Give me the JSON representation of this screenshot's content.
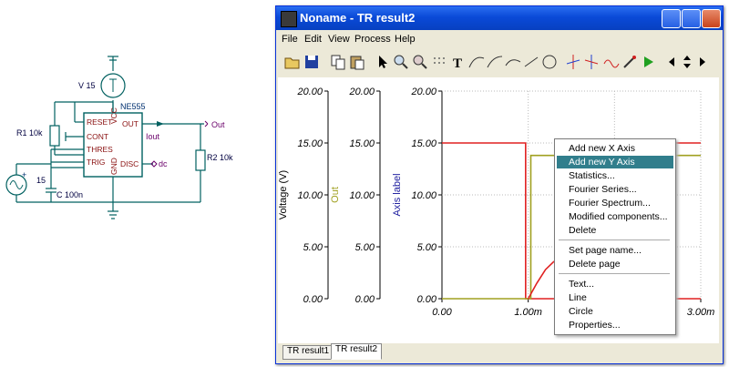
{
  "schematic": {
    "source_label": "V 15",
    "ic_name": "NE555",
    "pins": {
      "reset": "RESET",
      "cont": "CONT",
      "thres": "THRES",
      "trig": "TRIG",
      "out": "OUT",
      "disc": "DISC",
      "vcc": "VCC",
      "gnd": "GND"
    },
    "r1_label": "R1 10k",
    "r2_label": "R2 10k",
    "c_label": "C 100n",
    "gen_value": "15",
    "iout_label": "Iout",
    "dc_label": "dc",
    "out_label": "Out"
  },
  "window": {
    "title": "Noname - TR result2",
    "menu": [
      "File",
      "Edit",
      "View",
      "Process",
      "Help"
    ],
    "toolbar_icons": [
      "open-folder-icon",
      "save-disk-icon",
      "copy-icon",
      "paste-icon",
      "arrow-pointer-icon",
      "zoom-in-icon",
      "zoom-out-icon",
      "grid-icon",
      "text-tool-icon",
      "curve-tool-icon",
      "curve2-tool-icon",
      "curve3-tool-icon",
      "line-tool-icon",
      "circle-tool-icon",
      "cursor-a-icon",
      "cursor-b-icon",
      "waveform-icon",
      "probe-icon",
      "run-icon",
      "arrow-left-icon",
      "arrow-updown-icon",
      "arrow-right-icon"
    ]
  },
  "tabs": [
    "TR result1",
    "TR result2"
  ],
  "context_menu": {
    "items": [
      "Add new X Axis",
      "Add new Y Axis",
      "Statistics...",
      "Fourier Series...",
      "Fourier Spectrum...",
      "Modified components...",
      "Delete",
      "Set page name...",
      "Delete page",
      "Text...",
      "Line",
      "Circle",
      "Properties..."
    ],
    "highlighted": "Add new Y Axis"
  },
  "colors": {
    "voltage_trace": "#e02020",
    "out_trace": "#a0a020",
    "axis_label_blue": "#2020a0",
    "highlight": "#317e8c"
  },
  "chart_data": {
    "type": "line",
    "y_axes": [
      {
        "label": "Voltage (V)",
        "ticks": [
          "20.00",
          "15.00",
          "10.00",
          "5.00",
          "0.00"
        ],
        "ylim": [
          0,
          20
        ]
      },
      {
        "label": "Out",
        "ticks": [
          "20.00",
          "15.00",
          "10.00",
          "5.00",
          "0.00"
        ],
        "ylim": [
          0,
          20
        ]
      },
      {
        "label": "Axis label",
        "ticks": [
          "20.00",
          "15.00",
          "10.00",
          "5.00",
          "0.00"
        ],
        "ylim": [
          0,
          20
        ]
      }
    ],
    "x_ticks": [
      "0.00",
      "1.00m",
      "3.00m"
    ],
    "x_tick_values": [
      0,
      1,
      3
    ],
    "xlim": [
      0,
      3
    ],
    "grid": true,
    "series": [
      {
        "x": [
          0,
          0.97,
          0.97,
          3.0
        ],
        "y": [
          15,
          15,
          0,
          0
        ]
      },
      {
        "x": [
          0,
          1.0,
          1.03,
          1.03,
          1.3,
          3.0
        ],
        "y": [
          0,
          0,
          0,
          13.8,
          13.8,
          13.8
        ]
      },
      {
        "x": [
          1.0,
          1.1,
          1.2,
          1.3
        ],
        "y": [
          0,
          1.5,
          2.8,
          3.6
        ]
      },
      {
        "x": [
          1.3,
          3.0
        ],
        "y": [
          15,
          15
        ]
      }
    ]
  }
}
